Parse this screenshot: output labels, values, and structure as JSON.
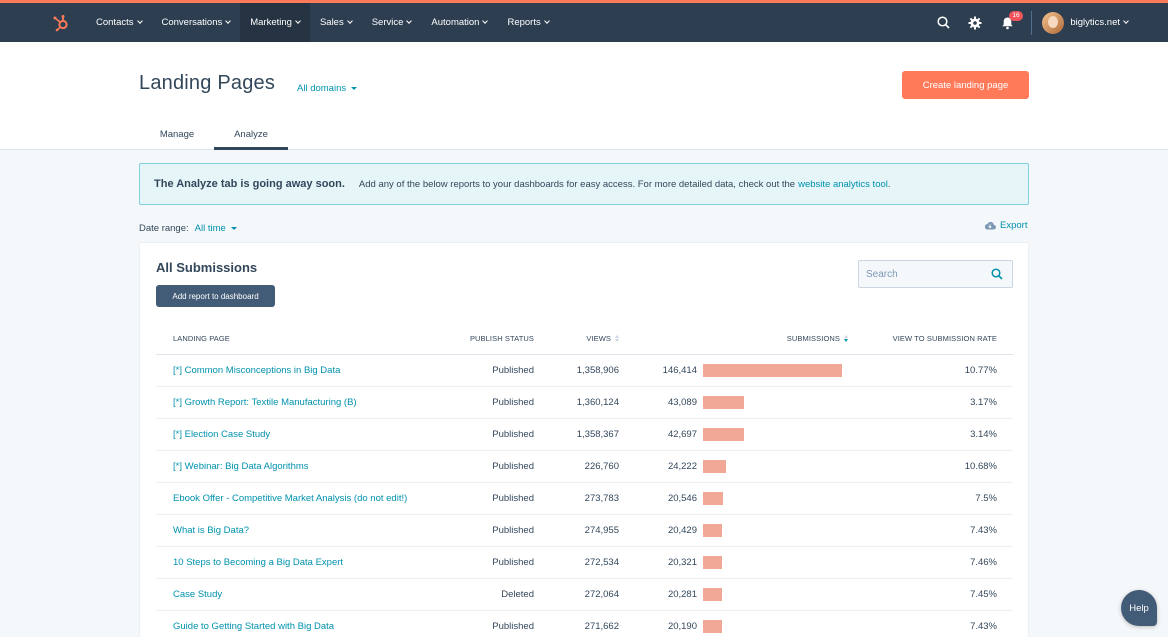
{
  "nav": {
    "items": [
      {
        "label": "Contacts"
      },
      {
        "label": "Conversations"
      },
      {
        "label": "Marketing"
      },
      {
        "label": "Sales"
      },
      {
        "label": "Service"
      },
      {
        "label": "Automation"
      },
      {
        "label": "Reports"
      }
    ],
    "active": "Marketing",
    "notification_count": "16",
    "account": "biglytics.net",
    "icons": [
      "hubspot-logo-icon",
      "search-icon",
      "gear-icon",
      "bell-icon",
      "avatar",
      "chevron-down-icon"
    ]
  },
  "header": {
    "title": "Landing Pages",
    "domain_filter": "All domains",
    "create_button": "Create landing page",
    "tabs": [
      {
        "label": "Manage"
      },
      {
        "label": "Analyze"
      }
    ],
    "active_tab": "Analyze"
  },
  "alert": {
    "title": "The Analyze tab is going away soon.",
    "body": "Add any of the below reports to your dashboards for easy access. For more detailed data, check out the",
    "link": "website analytics tool",
    "end": "."
  },
  "filters": {
    "date_range_label": "Date range:",
    "date_range_value": "All time",
    "export_label": "Export"
  },
  "report": {
    "title": "All Submissions",
    "add_button": "Add report to dashboard",
    "search_placeholder": "Search",
    "columns": {
      "landing_page": "LANDING PAGE",
      "publish_status": "PUBLISH STATUS",
      "views": "VIEWS",
      "submissions": "SUBMISSIONS",
      "rate": "VIEW TO SUBMISSION RATE"
    },
    "max_submissions": 146414,
    "rows": [
      {
        "name": "[*] Common Misconceptions in Big Data",
        "status": "Published",
        "views": "1,358,906",
        "submissions": "146,414",
        "submissions_value": 146414,
        "rate": "10.77%"
      },
      {
        "name": "[*] Growth Report: Textile Manufacturing (B)",
        "status": "Published",
        "views": "1,360,124",
        "submissions": "43,089",
        "submissions_value": 43089,
        "rate": "3.17%"
      },
      {
        "name": "[*] Election Case Study",
        "status": "Published",
        "views": "1,358,367",
        "submissions": "42,697",
        "submissions_value": 42697,
        "rate": "3.14%"
      },
      {
        "name": "[*] Webinar: Big Data Algorithms",
        "status": "Published",
        "views": "226,760",
        "submissions": "24,222",
        "submissions_value": 24222,
        "rate": "10.68%"
      },
      {
        "name": "Ebook Offer - Competitive Market Analysis (do not edit!)",
        "status": "Published",
        "views": "273,783",
        "submissions": "20,546",
        "submissions_value": 20546,
        "rate": "7.5%"
      },
      {
        "name": "What is Big Data?",
        "status": "Published",
        "views": "274,955",
        "submissions": "20,429",
        "submissions_value": 20429,
        "rate": "7.43%"
      },
      {
        "name": "10 Steps to Becoming a Big Data Expert",
        "status": "Published",
        "views": "272,534",
        "submissions": "20,321",
        "submissions_value": 20321,
        "rate": "7.46%"
      },
      {
        "name": "Case Study",
        "status": "Deleted",
        "views": "272,064",
        "submissions": "20,281",
        "submissions_value": 20281,
        "rate": "7.45%"
      },
      {
        "name": "Guide to Getting Started with Big Data",
        "status": "Published",
        "views": "271,662",
        "submissions": "20,190",
        "submissions_value": 20190,
        "rate": "7.43%"
      }
    ]
  },
  "help": {
    "label": "Help"
  },
  "colors": {
    "accent": "#ff7a59",
    "nav_bg": "#2d3e50",
    "link": "#0091ae",
    "bar": "#f2a897"
  }
}
